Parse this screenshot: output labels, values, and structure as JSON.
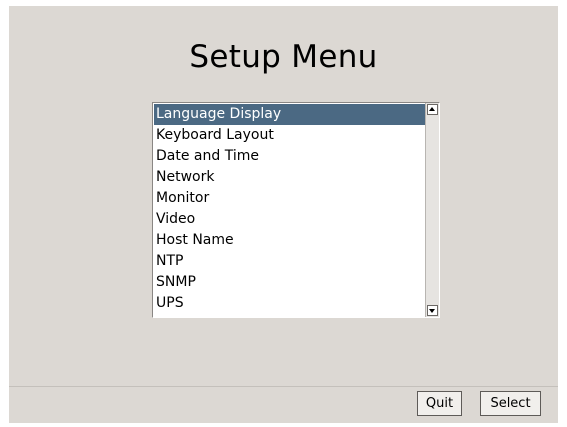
{
  "title": "Setup Menu",
  "menu": {
    "items": [
      "Language Display",
      "Keyboard Layout",
      "Date and Time",
      "Network",
      "Monitor",
      "Video",
      "Host Name",
      "NTP",
      "SNMP",
      "UPS"
    ],
    "selected_index": 0
  },
  "buttons": {
    "quit": "Quit",
    "select": "Select"
  },
  "colors": {
    "background": "#dcd8d3",
    "selection": "#4b6983"
  },
  "icons": {
    "scroll_up": "scroll-up-arrow-icon",
    "scroll_down": "scroll-down-arrow-icon"
  }
}
